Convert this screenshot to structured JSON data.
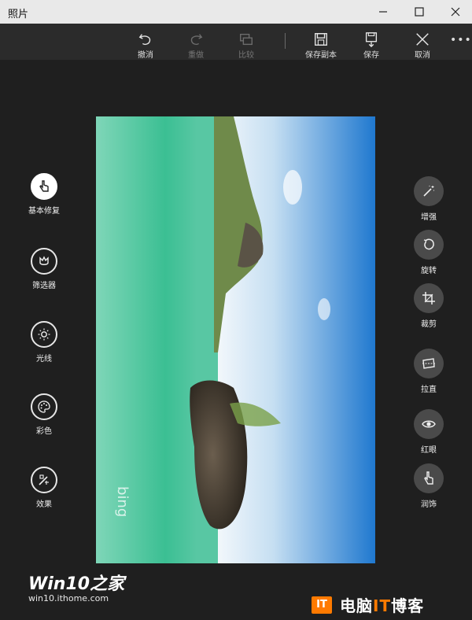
{
  "window": {
    "title": "照片"
  },
  "toolbar": {
    "undo_label": "撤消",
    "redo_label": "重做",
    "compare_label": "比较",
    "save_copy_label": "保存副本",
    "save_label": "保存",
    "cancel_label": "取消"
  },
  "left_tools": [
    {
      "label": "基本修复",
      "icon": "touch-icon"
    },
    {
      "label": "筛选器",
      "icon": "filter-icon"
    },
    {
      "label": "光线",
      "icon": "sun-icon"
    },
    {
      "label": "彩色",
      "icon": "palette-icon"
    },
    {
      "label": "效果",
      "icon": "effects-icon"
    }
  ],
  "right_tools": [
    {
      "label": "增强",
      "icon": "magic-wand-icon"
    },
    {
      "label": "旋转",
      "icon": "rotate-icon"
    },
    {
      "label": "裁剪",
      "icon": "crop-icon"
    },
    {
      "label": "拉直",
      "icon": "straighten-icon"
    },
    {
      "label": "红眼",
      "icon": "eye-icon"
    },
    {
      "label": "润饰",
      "icon": "retouch-icon"
    }
  ],
  "photo": {
    "watermark": "bing"
  },
  "watermarks": {
    "left_brand": "Win10之家",
    "left_url": "win10.ithome.com",
    "right_logo": "IT",
    "right_prefix": "电脑",
    "right_it": "IT",
    "right_suffix": "博客"
  },
  "colors": {
    "background": "#1f1f1f",
    "titlebar": "#e9e9e9",
    "toolbar": "#2b2b2b",
    "accent_orange": "#ff7a00"
  }
}
